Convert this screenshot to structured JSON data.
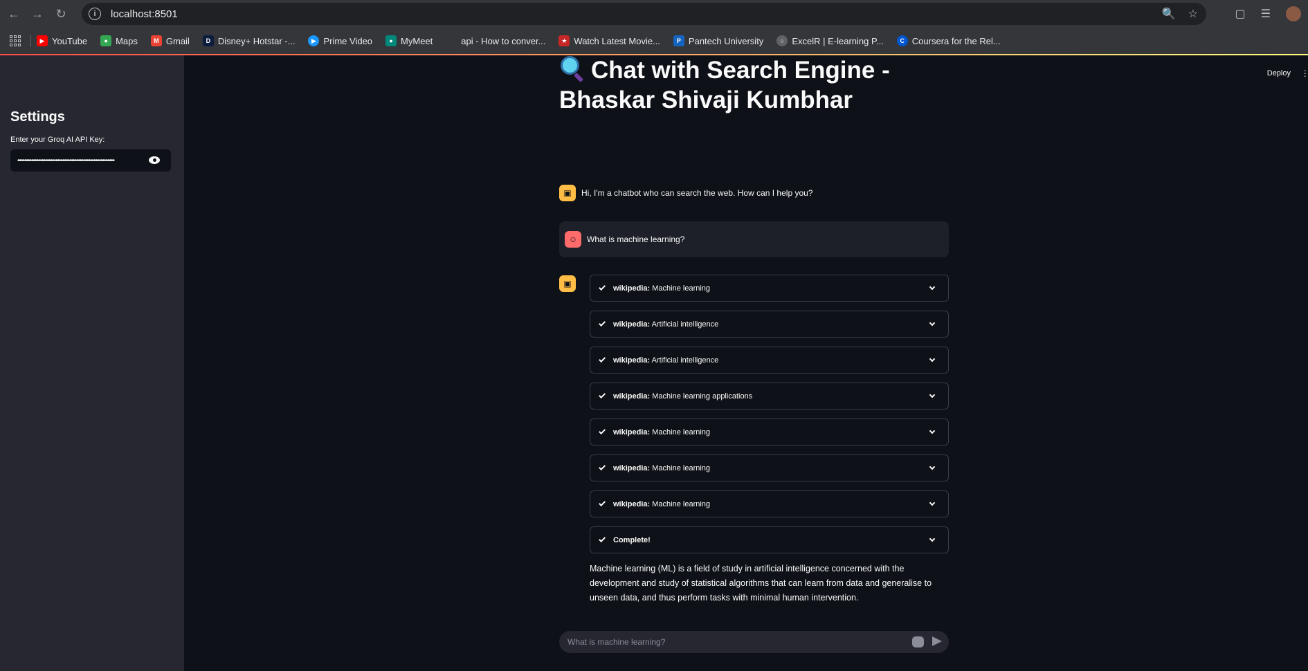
{
  "browser": {
    "url": "localhost:8501",
    "bookmarks": [
      {
        "label": "YouTube",
        "icon": "youtube-icon",
        "color": "#ff0000"
      },
      {
        "label": "Maps",
        "icon": "maps-icon",
        "color": "#34a853"
      },
      {
        "label": "Gmail",
        "icon": "gmail-icon",
        "color": "#ea4335"
      },
      {
        "label": "Disney+ Hotstar -...",
        "icon": "hotstar-icon",
        "color": "#0c1c3c"
      },
      {
        "label": "Prime Video",
        "icon": "prime-video-icon",
        "color": "#1a98ff"
      },
      {
        "label": "MyMeet",
        "icon": "meet-icon",
        "color": "#00897b"
      },
      {
        "label": "api - How to conver...",
        "icon": "stackoverflow-icon",
        "color": "#35363a"
      },
      {
        "label": "Watch Latest Movie...",
        "icon": "movie-icon",
        "color": "#c62828"
      },
      {
        "label": "Pantech University",
        "icon": "pantech-icon",
        "color": "#1565c0"
      },
      {
        "label": "ExcelR | E-learning P...",
        "icon": "globe-icon",
        "color": "#5f6368"
      },
      {
        "label": "Coursera for the Rel...",
        "icon": "coursera-icon",
        "color": "#0056d2"
      }
    ]
  },
  "app": {
    "deploy_label": "Deploy",
    "sidebar": {
      "title": "Settings",
      "api_key_label": "Enter your Groq AI API Key:",
      "api_key_value": "••••••••••••••••••••••••••••••••••••••••••••••••••••••••"
    },
    "title": "Chat with Search Engine - Bhaskar Shivaji Kumbhar",
    "messages": {
      "bot_greeting": "Hi, I'm a chatbot who can search the web. How can I help you?",
      "user_question": "What is machine learning?"
    },
    "steps": [
      {
        "tool": "wikipedia:",
        "query": "Machine learning"
      },
      {
        "tool": "wikipedia:",
        "query": "Artificial intelligence"
      },
      {
        "tool": "wikipedia:",
        "query": "Artificial intelligence"
      },
      {
        "tool": "wikipedia:",
        "query": "Machine learning applications"
      },
      {
        "tool": "wikipedia:",
        "query": "Machine learning"
      },
      {
        "tool": "wikipedia:",
        "query": "Machine learning"
      },
      {
        "tool": "wikipedia:",
        "query": "Machine learning"
      },
      {
        "tool": "Complete!",
        "query": ""
      }
    ],
    "answer": "Machine learning (ML) is a field of study in artificial intelligence concerned with the development and study of statistical algorithms that can learn from data and generalise to unseen data, and thus perform tasks with minimal human intervention.",
    "chat_input_placeholder": "What is machine learning?"
  }
}
